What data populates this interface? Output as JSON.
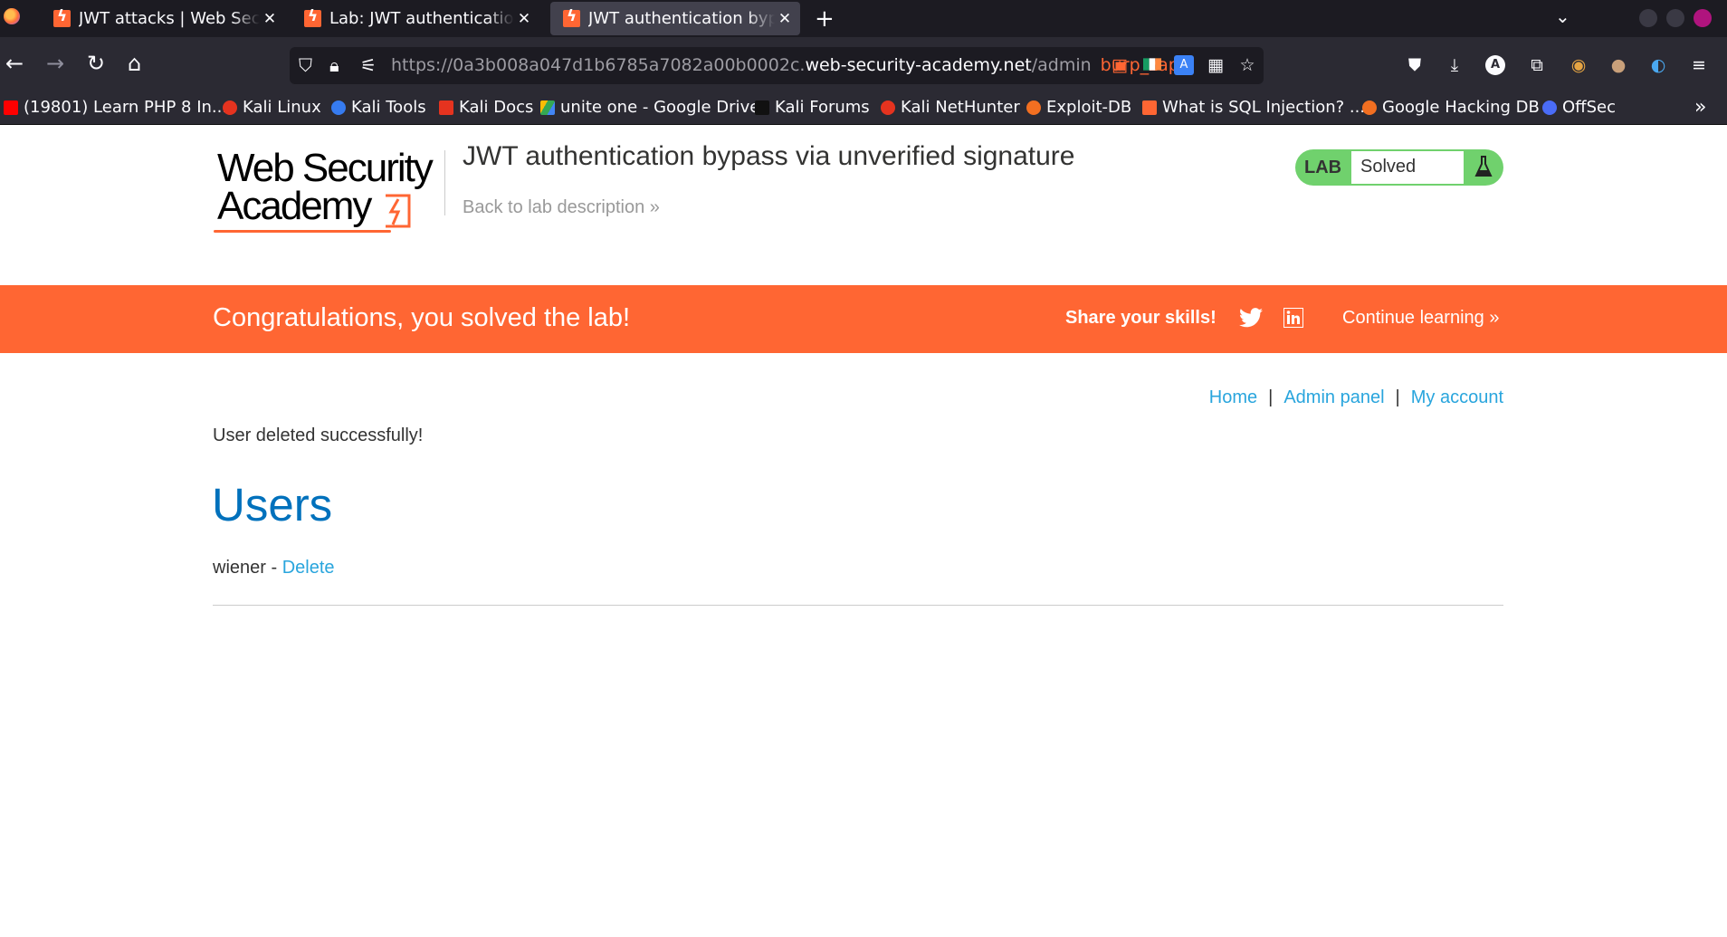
{
  "browser": {
    "tabs": [
      {
        "title": "JWT attacks | Web Security Academy"
      },
      {
        "title": "Lab: JWT authentication bypass via unverified signature"
      },
      {
        "title": "JWT authentication bypass via unverified signature"
      }
    ],
    "url_prefix": "https://0a3b008a047d1b6785a7082a00b0002c.",
    "url_domain": "web-security-academy.net",
    "url_path": "/admin",
    "container_label": "burp_zap",
    "bookmarks": [
      {
        "label": "(19801) Learn PHP 8 In...",
        "color": "#ff0000"
      },
      {
        "label": "Kali Linux",
        "color": "#e5331f"
      },
      {
        "label": "Kali Tools",
        "color": "#367bf0"
      },
      {
        "label": "Kali Docs",
        "color": "#e5331f"
      },
      {
        "label": "unite one - Google Drive",
        "color": "#34a853"
      },
      {
        "label": "Kali Forums",
        "color": "#222222"
      },
      {
        "label": "Kali NetHunter",
        "color": "#e5331f"
      },
      {
        "label": "Exploit-DB",
        "color": "#f26f21"
      },
      {
        "label": "What is SQL Injection? ...",
        "color": "#ff6633"
      },
      {
        "label": "Google Hacking DB",
        "color": "#f26f21"
      },
      {
        "label": "OffSec",
        "color": "#4a6cf7"
      }
    ]
  },
  "header": {
    "logo_line1": "Web Security",
    "logo_line2": "Academy",
    "lab_title": "JWT authentication bypass via unverified signature",
    "back_link": "Back to lab description",
    "status_label": "LAB",
    "status_value": "Solved"
  },
  "banner": {
    "message": "Congratulations, you solved the lab!",
    "share": "Share your skills!",
    "continue": "Continue learning"
  },
  "nav": {
    "home": "Home",
    "admin": "Admin panel",
    "account": "My account",
    "separator": "|"
  },
  "content": {
    "message": "User deleted successfully!",
    "heading": "Users",
    "users": [
      {
        "name": "wiener",
        "sep": " - ",
        "action": "Delete"
      }
    ]
  },
  "colors": {
    "accent": "#ff6633",
    "link": "#29a5dd",
    "heading": "#0071bc",
    "solved": "#70d16d"
  }
}
